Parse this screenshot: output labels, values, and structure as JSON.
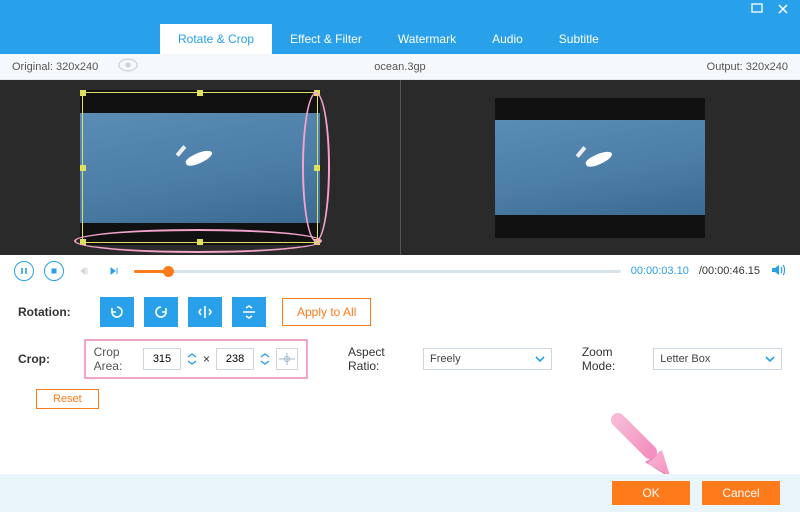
{
  "window": {
    "filename": "ocean.3gp"
  },
  "tabs": [
    "Rotate & Crop",
    "Effect & Filter",
    "Watermark",
    "Audio",
    "Subtitle"
  ],
  "info": {
    "original_label": "Original: 320x240",
    "output_label": "Output: 320x240"
  },
  "playback": {
    "current": "00:00:03.10",
    "total": "/00:00:46.15"
  },
  "rotation": {
    "label": "Rotation:",
    "apply_all": "Apply to All"
  },
  "crop": {
    "label": "Crop:",
    "area_label": "Crop Area:",
    "width": "315",
    "sep": "×",
    "height": "238",
    "reset": "Reset"
  },
  "aspect": {
    "label": "Aspect Ratio:",
    "value": "Freely"
  },
  "zoom": {
    "label": "Zoom Mode:",
    "value": "Letter Box"
  },
  "footer": {
    "ok": "OK",
    "cancel": "Cancel"
  }
}
